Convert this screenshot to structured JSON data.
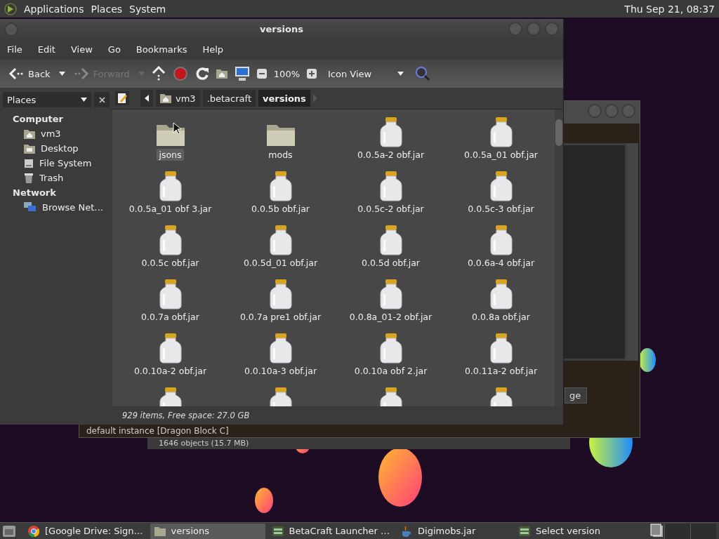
{
  "top_panel": {
    "menus": [
      "Applications",
      "Places",
      "System"
    ],
    "clock": "Thu Sep 21, 08:37"
  },
  "background_window": {
    "status": "default instance [Dragon Block C]",
    "button": "ge"
  },
  "background_window_2": {
    "status": "1646 objects (15.7 MB)"
  },
  "window": {
    "title": "versions",
    "menu": [
      "File",
      "Edit",
      "View",
      "Go",
      "Bookmarks",
      "Help"
    ],
    "toolbar": {
      "back": "Back",
      "forward": "Forward",
      "forward_disabled": true,
      "zoom": "100%",
      "view": "Icon View"
    },
    "sidebar": {
      "header": "Places",
      "sections": [
        {
          "title": "Computer",
          "items": [
            {
              "label": "vm3",
              "kind": "home"
            },
            {
              "label": "Desktop",
              "kind": "desktop"
            },
            {
              "label": "File System",
              "kind": "drive"
            },
            {
              "label": "Trash",
              "kind": "trash"
            }
          ]
        },
        {
          "title": "Network",
          "items": [
            {
              "label": "Browse Net…",
              "kind": "network"
            }
          ]
        }
      ]
    },
    "path": [
      {
        "label": "vm3",
        "kind": "home",
        "selected": false
      },
      {
        "label": ".betacraft",
        "kind": "folder",
        "selected": false
      },
      {
        "label": "versions",
        "kind": "folder",
        "selected": true
      }
    ],
    "files": [
      {
        "label": "jsons",
        "kind": "folder",
        "selected": true
      },
      {
        "label": "mods",
        "kind": "folder",
        "selected": false
      },
      {
        "label": "0.0.5a-2 obf.jar",
        "kind": "jar",
        "selected": false
      },
      {
        "label": "0.0.5a_01 obf.jar",
        "kind": "jar",
        "selected": false
      },
      {
        "label": "0.0.5a_01 obf 3.jar",
        "kind": "jar",
        "selected": false
      },
      {
        "label": "0.0.5b obf.jar",
        "kind": "jar",
        "selected": false
      },
      {
        "label": "0.0.5c-2 obf.jar",
        "kind": "jar",
        "selected": false
      },
      {
        "label": "0.0.5c-3 obf.jar",
        "kind": "jar",
        "selected": false
      },
      {
        "label": "0.0.5c obf.jar",
        "kind": "jar",
        "selected": false
      },
      {
        "label": "0.0.5d_01 obf.jar",
        "kind": "jar",
        "selected": false
      },
      {
        "label": "0.0.5d obf.jar",
        "kind": "jar",
        "selected": false
      },
      {
        "label": "0.0.6a-4 obf.jar",
        "kind": "jar",
        "selected": false
      },
      {
        "label": "0.0.7a obf.jar",
        "kind": "jar",
        "selected": false
      },
      {
        "label": "0.0.7a pre1 obf.jar",
        "kind": "jar",
        "selected": false
      },
      {
        "label": "0.0.8a_01-2 obf.jar",
        "kind": "jar",
        "selected": false
      },
      {
        "label": "0.0.8a obf.jar",
        "kind": "jar",
        "selected": false
      },
      {
        "label": "0.0.10a-2 obf.jar",
        "kind": "jar",
        "selected": false
      },
      {
        "label": "0.0.10a-3 obf.jar",
        "kind": "jar",
        "selected": false
      },
      {
        "label": "0.0.10a obf 2.jar",
        "kind": "jar",
        "selected": false
      },
      {
        "label": "0.0.11a-2 obf.jar",
        "kind": "jar",
        "selected": false
      },
      {
        "kind": "jar",
        "selected": false
      },
      {
        "kind": "jar",
        "selected": false
      },
      {
        "kind": "jar",
        "selected": false
      },
      {
        "kind": "jar",
        "selected": false
      }
    ],
    "status": "929 items, Free space: 27.0 GB"
  },
  "taskbar": [
    {
      "label": "[Google Drive: Sign…",
      "kind": "browser",
      "selected": false
    },
    {
      "label": "versions",
      "kind": "folder",
      "selected": true
    },
    {
      "label": "BetaCraft Launcher …",
      "kind": "betacraft",
      "selected": false
    },
    {
      "label": "Digimobs.jar",
      "kind": "java",
      "selected": false
    },
    {
      "label": "Select version",
      "kind": "betacraft",
      "selected": false
    }
  ]
}
